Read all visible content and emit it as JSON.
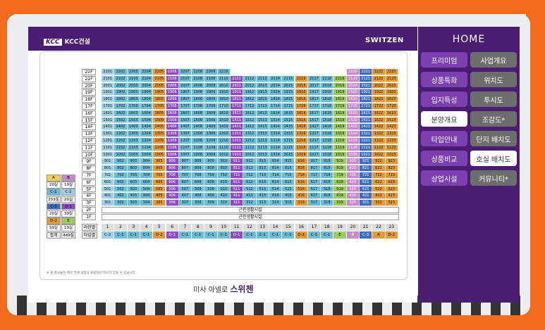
{
  "brand": {
    "left_logo": "KCC",
    "left_name": "KCC건설",
    "right_logo": "SWITZEN",
    "bottom_prefix": "미사 아넬로",
    "bottom_name": "스위첸"
  },
  "nav": {
    "home": "HOME",
    "left": [
      {
        "label": "프리미엄",
        "active": false
      },
      {
        "label": "상품특화",
        "active": false
      },
      {
        "label": "입지특성",
        "active": false
      },
      {
        "label": "분양개요",
        "active": true
      },
      {
        "label": "타입안내",
        "active": false
      },
      {
        "label": "상품비교",
        "active": false
      },
      {
        "label": "상업시설",
        "active": false
      }
    ],
    "right": [
      {
        "label": "사업개요",
        "active": false
      },
      {
        "label": "위치도",
        "active": false
      },
      {
        "label": "투시도",
        "active": false
      },
      {
        "label": "조감도*",
        "active": false
      },
      {
        "label": "단지 배치도",
        "active": false
      },
      {
        "label": "호실 배치도",
        "active": true
      },
      {
        "label": "커뮤니티*",
        "active": false
      }
    ]
  },
  "floors": [
    "22F",
    "21F",
    "20F",
    "19F",
    "18F",
    "17F",
    "16F",
    "15F",
    "14F",
    "13F",
    "12F",
    "11F",
    "10F",
    "9F",
    "8F",
    "7F",
    "6F",
    "5F",
    "4F",
    "3F",
    "2F",
    "1F"
  ],
  "facility_label": "근린생활시설",
  "lines": [
    "1",
    "2",
    "3",
    "4",
    "5",
    "6",
    "7",
    "8",
    "9",
    "10",
    "11",
    "12",
    "13",
    "14",
    "15",
    "16",
    "17",
    "18",
    "19",
    "20",
    "21",
    "22",
    "23"
  ],
  "types": [
    "C-2",
    "C-1",
    "C-1",
    "C-1",
    "D-2",
    "D-1",
    "C-1",
    "C-1",
    "C-1",
    "C-1",
    "D-1",
    "C-1",
    "C-1",
    "C-1",
    "C-1",
    "D-2",
    "C-1",
    "C-1",
    "E",
    "B",
    "C-3",
    "A",
    "D-2"
  ],
  "type_colors": {
    "A": "#e59a3a",
    "B": "#c98acb",
    "C-1": "#6cbcd6",
    "C-2": "#9fd0e6",
    "C-3": "#3d6dc2",
    "D-1": "#8e4cc4",
    "D-2": "#e59a3a",
    "E": "#9ccb5e"
  },
  "row_labels": {
    "line": "라인별",
    "type": "타입별"
  },
  "legend": [
    {
      "a": "A",
      "b": "B",
      "ca": "#f0cf55",
      "cb": "#c98acb"
    },
    {
      "a": "20실",
      "b": "19실",
      "ca": "#fff",
      "cb": "#fff"
    },
    {
      "a": "C-1",
      "b": "C-2",
      "ca": "#6cbcd6",
      "cb": "#9fd0e6"
    },
    {
      "a": "253실",
      "b": "20실",
      "ca": "#fff",
      "cb": "#fff"
    },
    {
      "a": "C-3",
      "b": "D-1",
      "ca": "#3d6dc2",
      "cb": "#8e4cc4"
    },
    {
      "a": "20실",
      "b": "39실",
      "ca": "#fff",
      "cb": "#fff"
    },
    {
      "a": "D-2",
      "b": "E",
      "ca": "#e59a3a",
      "cb": "#9ccb5e"
    },
    {
      "a": "59실",
      "b": "19실",
      "ca": "#fff",
      "cb": "#fff"
    },
    {
      "a": "합계",
      "b": "449실",
      "ca": "#eee",
      "cb": "#eee"
    }
  ],
  "footnote": "※ 본 홍보물은 계약 전에 과정상 오탈자나 착오가 있을 수 있습니다."
}
